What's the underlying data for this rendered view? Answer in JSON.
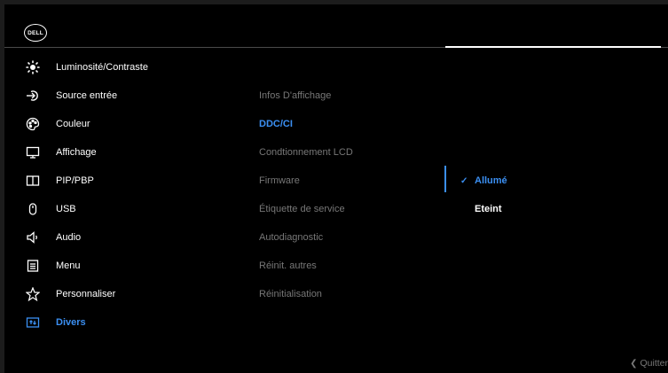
{
  "brand": {
    "logo_text": "DELL"
  },
  "menu": [
    {
      "label": "Luminosité/Contraste",
      "icon": "brightness-icon"
    },
    {
      "label": "Source entrée",
      "icon": "input-source-icon"
    },
    {
      "label": "Couleur",
      "icon": "color-palette-icon"
    },
    {
      "label": "Affichage",
      "icon": "display-icon"
    },
    {
      "label": "PIP/PBP",
      "icon": "pip-pbp-icon"
    },
    {
      "label": "USB",
      "icon": "usb-mouse-icon"
    },
    {
      "label": "Audio",
      "icon": "speaker-icon"
    },
    {
      "label": "Menu",
      "icon": "menu-icon"
    },
    {
      "label": "Personnaliser",
      "icon": "star-icon"
    },
    {
      "label": "Divers",
      "icon": "others-icon"
    }
  ],
  "submenu": [
    {
      "label": "Infos D'affichage"
    },
    {
      "label": "DDC/CI"
    },
    {
      "label": "Condtionnement LCD"
    },
    {
      "label": "Firmware"
    },
    {
      "label": "Étiquette de service"
    },
    {
      "label": "Autodiagnostic"
    },
    {
      "label": "Réinit. autres"
    },
    {
      "label": "Réinitialisation"
    }
  ],
  "options": [
    {
      "label": "Allumé",
      "checkmark": "✓"
    },
    {
      "label": "Eteint"
    }
  ],
  "footer": {
    "quit_label": "Quitter"
  },
  "colors": {
    "accent": "#3b8ff2",
    "background": "#000000",
    "dim_text": "#777777"
  }
}
